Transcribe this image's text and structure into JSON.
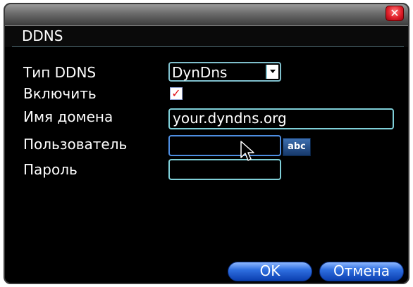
{
  "window": {
    "close_glyph": "✕"
  },
  "header": {
    "title": "DDNS"
  },
  "form": {
    "type_label": "Тип DDNS",
    "type_value": "DynDns",
    "enable_label": "Включить",
    "enable_checked": true,
    "check_glyph": "✓",
    "domain_label": "Имя домена",
    "domain_value": "your.dyndns.org",
    "user_label": "Пользователь",
    "user_value": "",
    "password_label": "Пароль",
    "password_value": "",
    "keyboard_label": "abc"
  },
  "buttons": {
    "ok_label": "OK",
    "cancel_label": "Отмена"
  },
  "colors": {
    "background": "#000000",
    "accent_border": "#7fcfd8",
    "button_blue": "#2f6fe0",
    "close_red": "#e0202a"
  }
}
